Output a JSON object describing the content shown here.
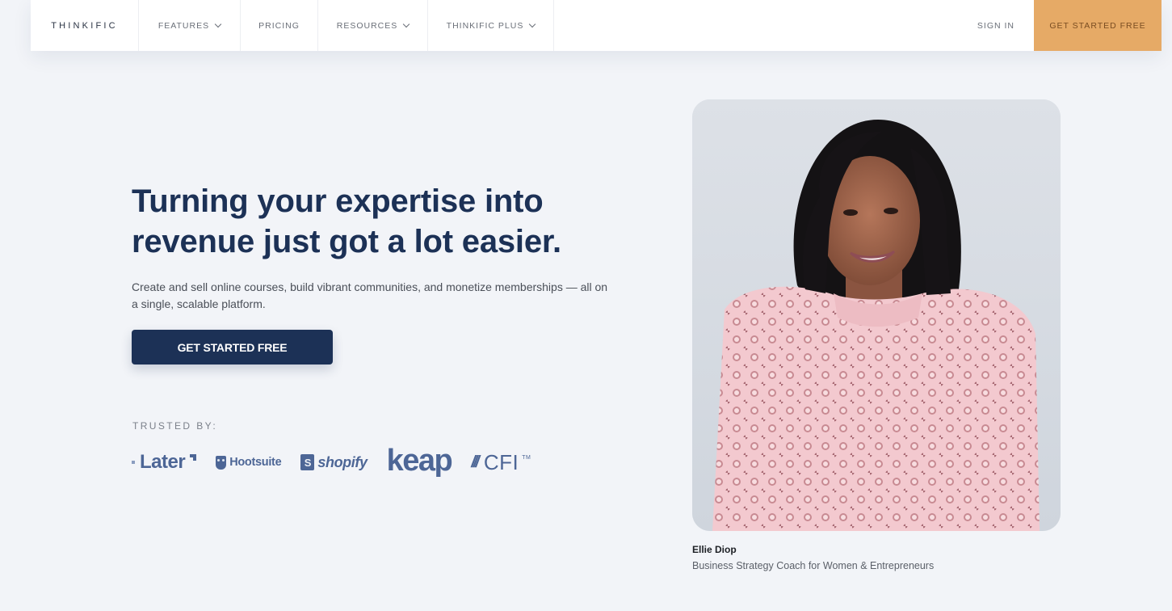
{
  "nav": {
    "logo": "THINKIFIC",
    "items": [
      {
        "label": "FEATURES",
        "has_dropdown": true,
        "icon": "chevron-down-icon"
      },
      {
        "label": "PRICING",
        "has_dropdown": false
      },
      {
        "label": "RESOURCES",
        "has_dropdown": true,
        "icon": "chevron-down-icon"
      },
      {
        "label": "THINKIFIC PLUS",
        "has_dropdown": true,
        "icon": "chevron-down-icon"
      }
    ],
    "sign_in": "SIGN IN",
    "cta": "GET STARTED FREE"
  },
  "hero": {
    "title": "Turning your expertise into revenue just got a lot easier.",
    "subtitle": "Create and sell online courses, build vibrant communities, and monetize memberships — all on a single, scalable platform.",
    "cta": "GET STARTED FREE",
    "trusted_label": "TRUSTED BY:",
    "logos": {
      "later": "Later",
      "hootsuite": "Hootsuite",
      "shopify": "shopify",
      "shopify_bag": "S",
      "keap": "keap",
      "cfi_slashes": "///",
      "cfi": "CFI",
      "cfi_tm": "TM"
    }
  },
  "testimonial": {
    "name": "Ellie Diop",
    "role": "Business Strategy Coach for Women & Entrepreneurs"
  },
  "colors": {
    "background": "#f2f4f8",
    "brand_navy": "#1c3156",
    "nav_cta": "#e6aa66",
    "logo_blue": "#4d6696"
  }
}
